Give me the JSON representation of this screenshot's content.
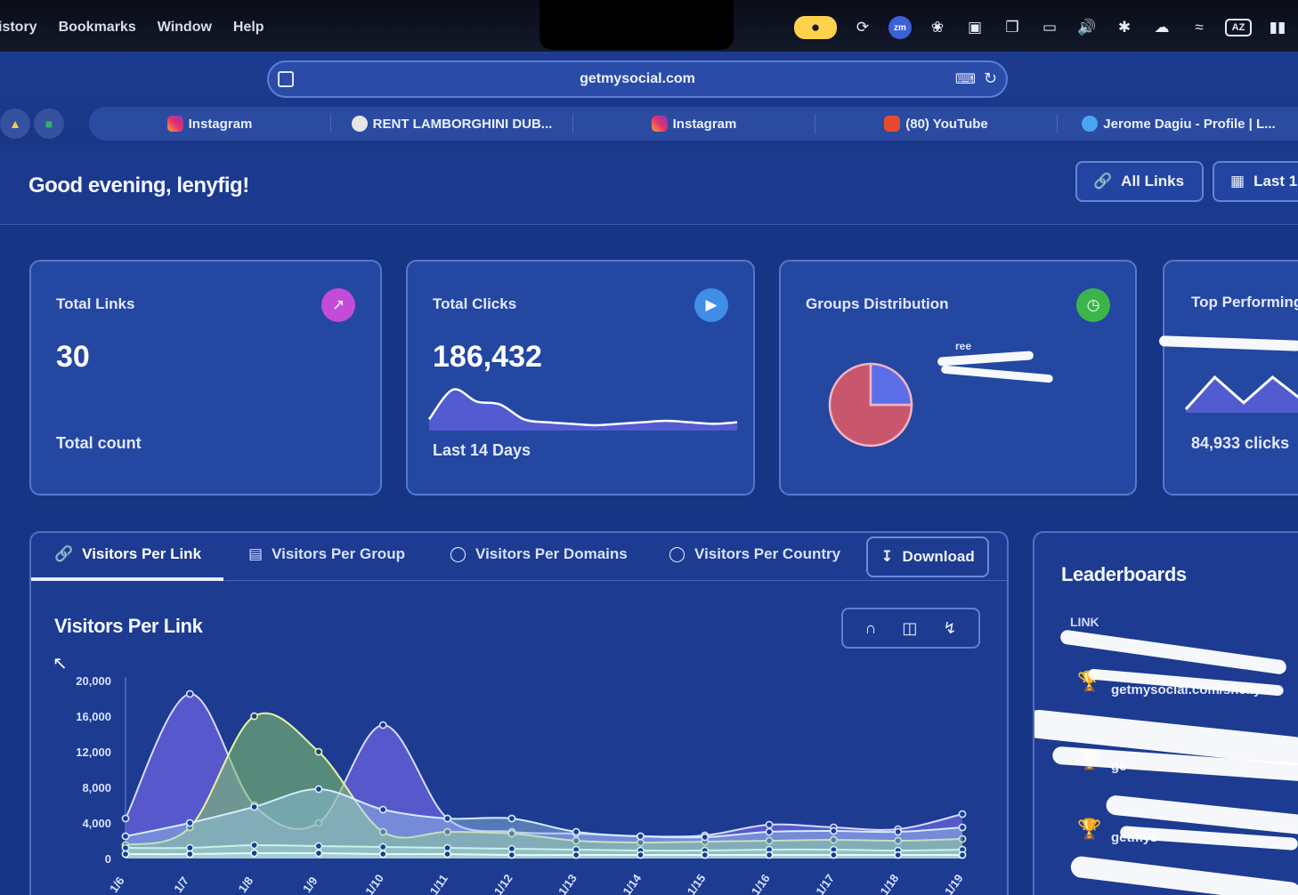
{
  "menubar": {
    "items": [
      "istory",
      "Bookmarks",
      "Window",
      "Help"
    ],
    "status_icons": [
      "active-app-icon",
      "copilot-icon",
      "zoom-icon",
      "chatgpt-icon",
      "extension-icon",
      "screens-icon",
      "display-icon",
      "volume-icon",
      "bluetooth-icon",
      "weather-icon",
      "wifi-icon",
      "keyboard-layout-icon",
      "battery-icon"
    ],
    "keyboard_label": "AZ",
    "zoom_label": "zm"
  },
  "browser": {
    "url": "getmysocial.com",
    "tabs": [
      {
        "label": "Instagram",
        "icon": "instagram-icon"
      },
      {
        "label": "RENT LAMBORGHINI DUB...",
        "icon": "globe-icon"
      },
      {
        "label": "Instagram",
        "icon": "instagram-icon"
      },
      {
        "label": "(80) YouTube",
        "icon": "youtube-icon"
      },
      {
        "label": "Jerome Dagiu - Profile | L...",
        "icon": "profile-icon"
      }
    ]
  },
  "header": {
    "greeting": "Good evening, lenyfig!",
    "all_links_label": "All Links",
    "date_range_label": "Last 1"
  },
  "cards": {
    "total_links": {
      "title": "Total Links",
      "value": "30",
      "sub": "Total count"
    },
    "total_clicks": {
      "title": "Total Clicks",
      "value": "186,432",
      "sub": "Last 14 Days"
    },
    "groups": {
      "title": "Groups Distribution",
      "legend_fragment": "ree"
    },
    "top": {
      "title": "Top Performing",
      "value": "84,933 clicks"
    }
  },
  "panel": {
    "tabs": [
      "Visitors Per Link",
      "Visitors Per Group",
      "Visitors Per Domains",
      "Visitors Per Country"
    ],
    "download_label": "Download",
    "chart_title": "Visitors Per Link"
  },
  "leaderboard": {
    "title": "Leaderboards",
    "column": "LINK",
    "rows": [
      "getmysocial.com/shelly/...",
      "ge",
      "getmys"
    ]
  },
  "colors": {
    "accent_purple": "#c44bd8",
    "accent_blue": "#3f8ee8",
    "accent_green": "#3bb54a",
    "series_purple": "#6b63e0",
    "series_green": "#7fbf6a",
    "series_light": "#9cc8e8",
    "pie_red": "#c8576e",
    "pie_blue": "#5b6ee8"
  },
  "chart_data": {
    "type": "area",
    "title": "Visitors Per Link",
    "x": [
      "1/6",
      "1/7",
      "1/8",
      "1/9",
      "1/10",
      "1/11",
      "1/12",
      "1/13",
      "1/14",
      "1/15",
      "1/16",
      "1/17",
      "1/18",
      "1/19"
    ],
    "ylim": [
      0,
      20000
    ],
    "yticks": [
      0,
      4000,
      8000,
      12000,
      16000,
      20000
    ],
    "series": [
      {
        "values": [
          4500,
          18500,
          6000,
          4000,
          15000,
          4500,
          3000,
          2800,
          2500,
          2600,
          3800,
          3500,
          3300,
          5000
        ]
      },
      {
        "values": [
          1500,
          3500,
          16000,
          12000,
          3000,
          3000,
          2800,
          2000,
          1800,
          1900,
          2000,
          2100,
          2000,
          2200
        ]
      },
      {
        "values": [
          2500,
          4000,
          5800,
          7800,
          5500,
          4500,
          4500,
          3000,
          2500,
          2400,
          3000,
          3100,
          3000,
          3500
        ]
      },
      {
        "values": [
          1200,
          1200,
          1500,
          1400,
          1300,
          1200,
          1100,
          1000,
          900,
          900,
          1000,
          1000,
          900,
          1000
        ]
      },
      {
        "values": [
          500,
          500,
          600,
          600,
          500,
          500,
          400,
          400,
          400,
          400,
          400,
          400,
          400,
          400
        ]
      }
    ]
  },
  "sparkline_data": {
    "values": [
      2,
      12,
      8,
      7,
      2,
      1,
      0.5,
      0,
      0.5,
      1,
      1.5,
      1,
      0.5,
      1
    ]
  },
  "top_sparkline_data": {
    "values": [
      0,
      10,
      2,
      10,
      3
    ]
  },
  "pie_data": {
    "values": [
      75,
      25
    ]
  }
}
